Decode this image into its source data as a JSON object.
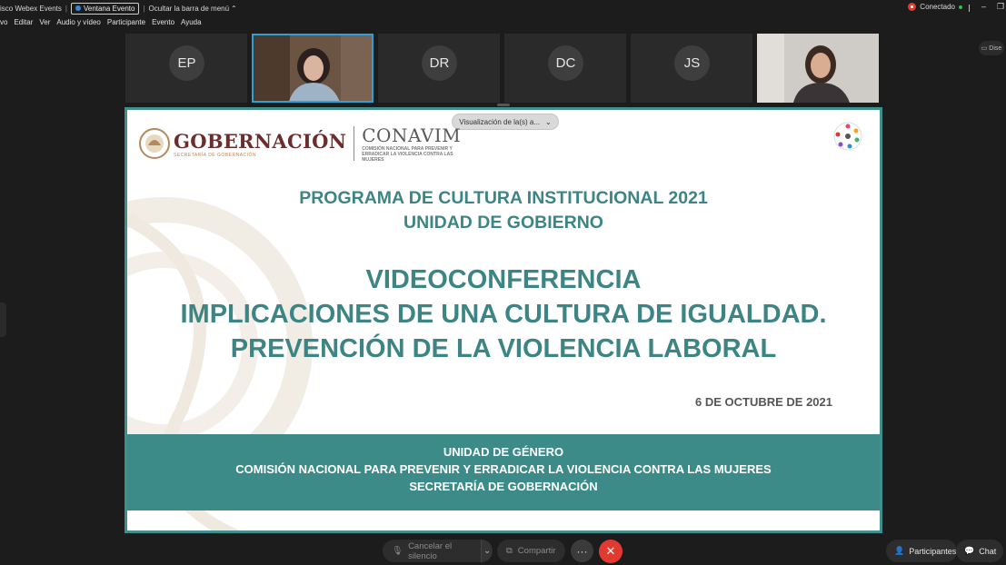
{
  "titlebar": {
    "app_name": "isco Webex Events",
    "event_window_label": "Ventana Evento",
    "hide_menu_label": "Ocultar la barra de menú",
    "status": "Conectado"
  },
  "menu": [
    "vo",
    "Editar",
    "Ver",
    "Audio y vídeo",
    "Participante",
    "Evento",
    "Ayuda"
  ],
  "participants": [
    {
      "initials": "EP"
    },
    {
      "initials": ""
    },
    {
      "initials": "DR"
    },
    {
      "initials": "DC"
    },
    {
      "initials": "JS"
    },
    {
      "initials": ""
    }
  ],
  "side_button_label": "Dise",
  "share": {
    "view_label": "Visualización de la(s) a...",
    "logo_gob": "GOBERNACIÓN",
    "logo_gob_sub": "SECRETARÍA DE GOBERNACIÓN",
    "logo_conavim": "CONAVIM",
    "logo_conavim_sub": "COMISIÓN NACIONAL PARA PREVENIR Y ERRADICAR LA VIOLENCIA CONTRA LAS MUJERES",
    "program_line1": "PROGRAMA DE CULTURA INSTITUCIONAL 2021",
    "program_line2": "UNIDAD DE GOBIERNO",
    "title_line1": "VIDEOCONFERENCIA",
    "title_line2": "IMPLICACIONES DE UNA CULTURA DE IGUALDAD.",
    "title_line3": "PREVENCIÓN DE LA VIOLENCIA LABORAL",
    "date": "6 DE OCTUBRE DE 2021",
    "footer_line1": "UNIDAD DE GÉNERO",
    "footer_line2": "COMISIÓN NACIONAL PARA PREVENIR Y ERRADICAR LA VIOLENCIA CONTRA LAS MUJERES",
    "footer_line3": "SECRETARÍA DE GOBERNACIÓN"
  },
  "controls": {
    "mute_label": "Cancelar el silencio",
    "share_label": "Compartir",
    "participants_label": "Participantes",
    "chat_label": "Chat"
  },
  "colors": {
    "accent_teal": "#3d8b89",
    "leave_red": "#e03a31",
    "active_border": "#2f9fd8"
  }
}
